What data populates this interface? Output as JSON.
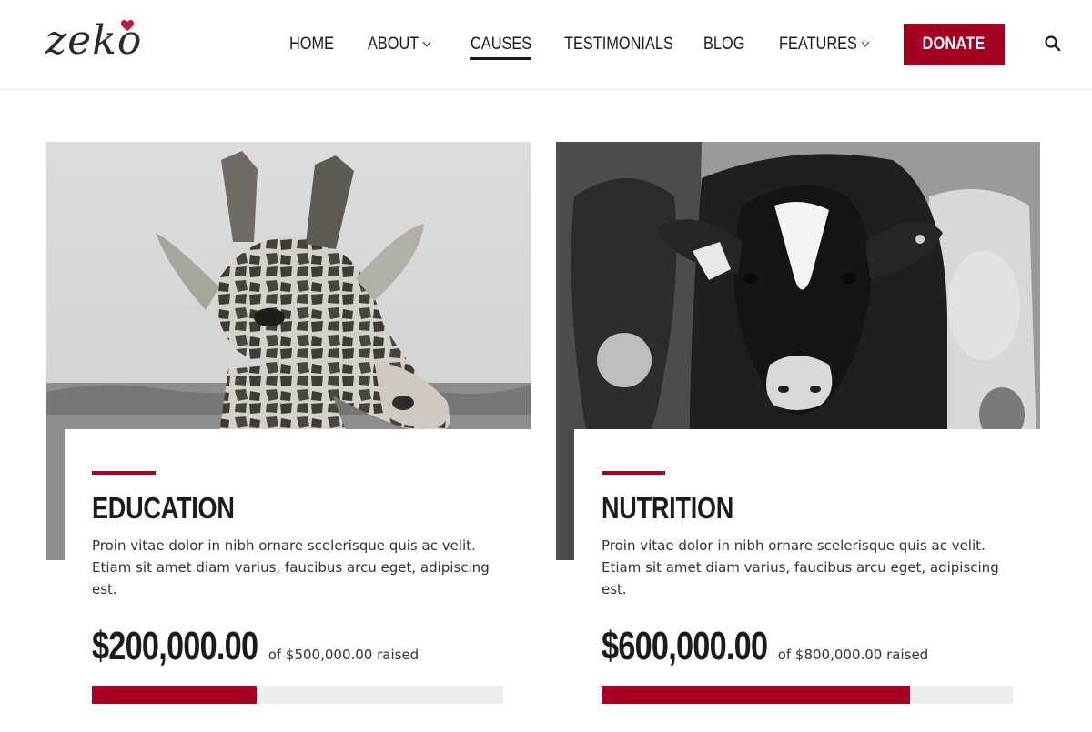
{
  "header": {
    "logo_text": "zeko",
    "nav": [
      {
        "label": "Home",
        "has_dropdown": false,
        "active": false
      },
      {
        "label": "About",
        "has_dropdown": true,
        "active": false
      },
      {
        "label": "Causes",
        "has_dropdown": false,
        "active": true
      },
      {
        "label": "Testimonials",
        "has_dropdown": false,
        "active": false
      },
      {
        "label": "Blog",
        "has_dropdown": false,
        "active": false
      },
      {
        "label": "Features",
        "has_dropdown": true,
        "active": false
      }
    ],
    "donate_label": "Donate",
    "search_icon": "search-icon"
  },
  "colors": {
    "accent": "#a50021",
    "text": "#1b1b1b",
    "progress_track": "#eeeeee"
  },
  "causes": [
    {
      "title": "Education",
      "description": "Proin vitae dolor in nibh ornare scelerisque quis ac velit. Etiam sit amet diam varius, faucibus arcu eget, adipiscing est.",
      "raised": "$200,000.00",
      "goal_text": "of $500,000.00 raised",
      "progress_fraction": 0.4,
      "image": "giraffe-photo"
    },
    {
      "title": "Nutrition",
      "description": "Proin vitae dolor in nibh ornare scelerisque quis ac velit. Etiam sit amet diam varius, faucibus arcu eget, adipiscing est.",
      "raised": "$600,000.00",
      "goal_text": "of $800,000.00 raised",
      "progress_fraction": 0.75,
      "image": "cow-photo"
    }
  ]
}
